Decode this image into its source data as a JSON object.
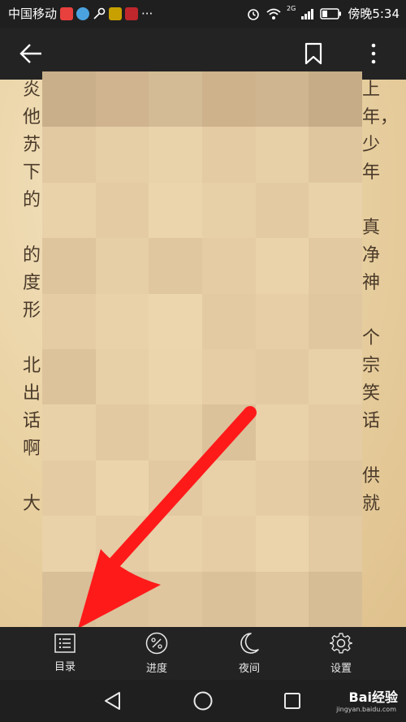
{
  "status_bar": {
    "carrier": "中国移动",
    "more": "···",
    "network": "2G",
    "time": "傍晚5:34"
  },
  "top_bar": {
    "back_icon": "arrow-left-icon",
    "bookmark_icon": "bookmark-icon",
    "more_icon": "more-vertical-icon"
  },
  "reader": {
    "left_column": [
      "炎",
      "他",
      "苏",
      "下",
      "的",
      "",
      "的",
      "度",
      "形",
      "",
      "北",
      "出",
      "话",
      "啊",
      "",
      "大"
    ],
    "right_column": [
      "上",
      "年，",
      "少",
      "年",
      "",
      "真",
      "净",
      "神",
      "",
      "个",
      "宗",
      "笑",
      "话",
      "",
      "供",
      "就"
    ]
  },
  "bottom_menu": {
    "items": [
      {
        "label": "目录",
        "icon": "list-icon"
      },
      {
        "label": "进度",
        "icon": "percent-icon"
      },
      {
        "label": "夜间",
        "icon": "moon-icon"
      },
      {
        "label": "设置",
        "icon": "gear-icon"
      }
    ]
  },
  "nav_bar": {
    "watermark": "Bai经验",
    "watermark_sub": "jingyan.baidu.com"
  },
  "colors": {
    "bar_bg": "#232323",
    "paper": "#ead3a5",
    "text": "#4a3a2a",
    "arrow": "#ff1a1a"
  }
}
